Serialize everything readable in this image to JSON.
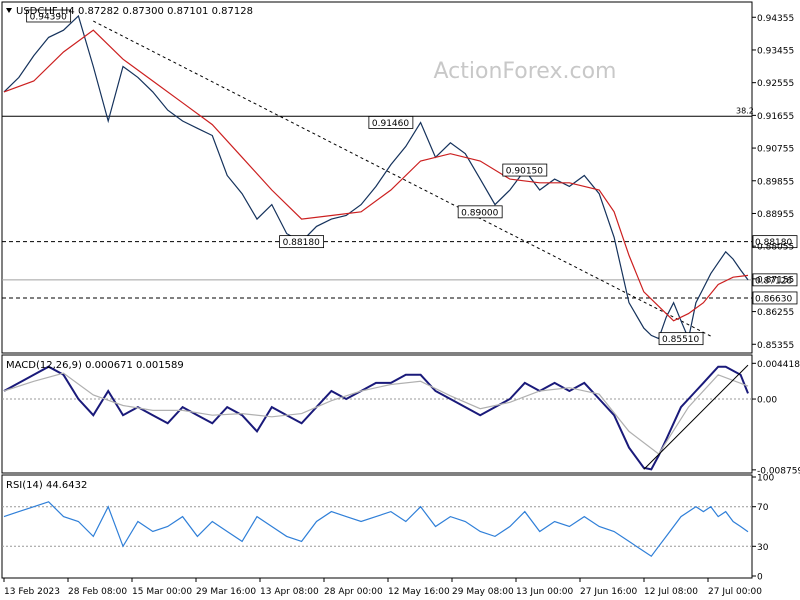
{
  "chart_data": [
    {
      "type": "line",
      "panel": "price",
      "title": "USDCHF,H4",
      "ohlc": "0.87282 0.87300 0.87101 0.87128",
      "watermark": "ActionForex.com",
      "y_ticks": [
        "0.94355",
        "0.93455",
        "0.92555",
        "0.91655",
        "0.90755",
        "0.89855",
        "0.88955",
        "0.88055",
        "0.87155",
        "0.86255",
        "0.85355"
      ],
      "ylim": [
        0.8517,
        0.9472
      ],
      "x_ticks": [
        "13 Feb 2023",
        "28 Feb 08:00",
        "15 Mar 00:00",
        "29 Mar 16:00",
        "13 Apr 08:00",
        "28 Apr 00:00",
        "12 May 16:00",
        "29 May 08:00",
        "13 Jun 00:00",
        "27 Jun 16:00",
        "12 Jul 08:00",
        "27 Jul 00:00"
      ],
      "levels": [
        {
          "label": "38.2",
          "value": 0.9163,
          "style": "solid"
        },
        {
          "label": "0.88180",
          "value": 0.8818,
          "style": "dashed"
        },
        {
          "label": "0.86630",
          "value": 0.8663,
          "style": "dashed"
        },
        {
          "label": "0.87128",
          "value": 0.87128,
          "style": "current"
        }
      ],
      "annotations": [
        {
          "text": "0.94390",
          "x": 0.06,
          "y": 0.9439
        },
        {
          "text": "0.91460",
          "x": 0.52,
          "y": 0.9146
        },
        {
          "text": "0.90150",
          "x": 0.7,
          "y": 0.9015
        },
        {
          "text": "0.89000",
          "x": 0.64,
          "y": 0.89
        },
        {
          "text": "0.88180",
          "x": 0.4,
          "y": 0.8818
        },
        {
          "text": "0.85510",
          "x": 0.91,
          "y": 0.8551
        }
      ],
      "trendline": {
        "from": [
          0.12,
          0.9425
        ],
        "to": [
          0.95,
          0.8558
        ]
      },
      "series": [
        {
          "name": "price",
          "color": "#15325c",
          "x": [
            0.0,
            0.02,
            0.04,
            0.06,
            0.08,
            0.1,
            0.12,
            0.14,
            0.16,
            0.18,
            0.2,
            0.22,
            0.24,
            0.26,
            0.28,
            0.3,
            0.32,
            0.34,
            0.36,
            0.38,
            0.4,
            0.42,
            0.44,
            0.46,
            0.48,
            0.5,
            0.52,
            0.54,
            0.56,
            0.58,
            0.6,
            0.62,
            0.64,
            0.66,
            0.68,
            0.7,
            0.72,
            0.74,
            0.76,
            0.78,
            0.8,
            0.82,
            0.84,
            0.86,
            0.87,
            0.88,
            0.89,
            0.9,
            0.91,
            0.92,
            0.93,
            0.94,
            0.95,
            0.96,
            0.97,
            0.98,
            0.99,
            1.0
          ],
          "y": [
            0.923,
            0.927,
            0.933,
            0.938,
            0.94,
            0.9439,
            0.93,
            0.915,
            0.93,
            0.927,
            0.923,
            0.918,
            0.915,
            0.913,
            0.911,
            0.9,
            0.895,
            0.888,
            0.892,
            0.884,
            0.8818,
            0.886,
            0.888,
            0.889,
            0.892,
            0.897,
            0.903,
            0.908,
            0.9146,
            0.905,
            0.909,
            0.906,
            0.899,
            0.892,
            0.896,
            0.9015,
            0.896,
            0.899,
            0.897,
            0.9,
            0.895,
            0.883,
            0.865,
            0.858,
            0.856,
            0.8551,
            0.861,
            0.865,
            0.86,
            0.8551,
            0.865,
            0.869,
            0.873,
            0.876,
            0.879,
            0.877,
            0.874,
            0.87128
          ]
        },
        {
          "name": "ma",
          "color": "#cc2020",
          "x": [
            0.0,
            0.04,
            0.08,
            0.12,
            0.16,
            0.2,
            0.24,
            0.28,
            0.32,
            0.36,
            0.4,
            0.44,
            0.48,
            0.52,
            0.56,
            0.6,
            0.64,
            0.68,
            0.72,
            0.76,
            0.8,
            0.82,
            0.84,
            0.86,
            0.88,
            0.9,
            0.92,
            0.94,
            0.96,
            0.98,
            1.0
          ],
          "y": [
            0.923,
            0.926,
            0.934,
            0.94,
            0.932,
            0.926,
            0.92,
            0.914,
            0.905,
            0.896,
            0.888,
            0.889,
            0.89,
            0.896,
            0.904,
            0.906,
            0.904,
            0.899,
            0.898,
            0.898,
            0.896,
            0.89,
            0.878,
            0.868,
            0.864,
            0.86,
            0.862,
            0.865,
            0.87,
            0.872,
            0.8725
          ]
        }
      ]
    },
    {
      "type": "line",
      "panel": "macd",
      "title": "MACD(12,26,9) 0.000671 0.001589",
      "y_ticks": [
        "0.004418",
        "0.00",
        "-0.008759"
      ],
      "ylim": [
        -0.0089,
        0.0052
      ],
      "series": [
        {
          "name": "macd",
          "color": "#1a1a7a",
          "x": [
            0.0,
            0.02,
            0.04,
            0.06,
            0.08,
            0.1,
            0.12,
            0.14,
            0.16,
            0.18,
            0.2,
            0.22,
            0.24,
            0.26,
            0.28,
            0.3,
            0.32,
            0.34,
            0.36,
            0.38,
            0.4,
            0.42,
            0.44,
            0.46,
            0.48,
            0.5,
            0.52,
            0.54,
            0.56,
            0.58,
            0.6,
            0.62,
            0.64,
            0.66,
            0.68,
            0.7,
            0.72,
            0.74,
            0.76,
            0.78,
            0.8,
            0.82,
            0.84,
            0.86,
            0.87,
            0.88,
            0.89,
            0.9,
            0.91,
            0.92,
            0.93,
            0.94,
            0.95,
            0.96,
            0.97,
            0.98,
            0.99,
            1.0
          ],
          "y": [
            0.001,
            0.002,
            0.003,
            0.004,
            0.003,
            0.0,
            -0.002,
            0.001,
            -0.002,
            -0.001,
            -0.002,
            -0.003,
            -0.001,
            -0.002,
            -0.003,
            -0.001,
            -0.002,
            -0.004,
            -0.001,
            -0.002,
            -0.003,
            -0.001,
            0.001,
            0.0,
            0.001,
            0.002,
            0.002,
            0.003,
            0.003,
            0.001,
            0.0,
            -0.001,
            -0.002,
            -0.001,
            0.0,
            0.002,
            0.001,
            0.002,
            0.001,
            0.002,
            0.0,
            -0.002,
            -0.006,
            -0.0085,
            -0.0087,
            -0.007,
            -0.005,
            -0.003,
            -0.001,
            0.0,
            0.001,
            0.002,
            0.003,
            0.004,
            0.004,
            0.0035,
            0.003,
            0.0007
          ]
        },
        {
          "name": "signal",
          "color": "#b0b0b0",
          "x": [
            0.0,
            0.04,
            0.08,
            0.12,
            0.16,
            0.2,
            0.24,
            0.28,
            0.32,
            0.36,
            0.4,
            0.44,
            0.48,
            0.52,
            0.56,
            0.6,
            0.64,
            0.68,
            0.72,
            0.76,
            0.8,
            0.84,
            0.88,
            0.92,
            0.96,
            1.0
          ],
          "y": [
            0.001,
            0.0022,
            0.0032,
            0.0005,
            -0.0008,
            -0.0014,
            -0.0014,
            -0.002,
            -0.0018,
            -0.0022,
            -0.0018,
            -0.0002,
            0.001,
            0.0018,
            0.0022,
            0.0004,
            -0.0012,
            -0.0004,
            0.001,
            0.0014,
            0.0006,
            -0.004,
            -0.0068,
            -0.001,
            0.003,
            0.0016
          ]
        }
      ],
      "trendline": {
        "from": [
          0.86,
          -0.0087
        ],
        "to": [
          1.0,
          0.0042
        ]
      }
    },
    {
      "type": "line",
      "panel": "rsi",
      "title": "RSI(14) 44.6432",
      "y_ticks": [
        "100",
        "70",
        "30",
        "0"
      ],
      "ylim": [
        0,
        100
      ],
      "levels": [
        70,
        30
      ],
      "series": [
        {
          "name": "rsi",
          "color": "#2f7fd8",
          "x": [
            0.0,
            0.02,
            0.04,
            0.06,
            0.08,
            0.1,
            0.12,
            0.14,
            0.16,
            0.18,
            0.2,
            0.22,
            0.24,
            0.26,
            0.28,
            0.3,
            0.32,
            0.34,
            0.36,
            0.38,
            0.4,
            0.42,
            0.44,
            0.46,
            0.48,
            0.5,
            0.52,
            0.54,
            0.56,
            0.58,
            0.6,
            0.62,
            0.64,
            0.66,
            0.68,
            0.7,
            0.72,
            0.74,
            0.76,
            0.78,
            0.8,
            0.82,
            0.84,
            0.86,
            0.87,
            0.88,
            0.89,
            0.9,
            0.91,
            0.92,
            0.93,
            0.94,
            0.95,
            0.96,
            0.97,
            0.98,
            0.99,
            1.0
          ],
          "y": [
            60,
            65,
            70,
            75,
            60,
            55,
            40,
            70,
            30,
            55,
            45,
            50,
            60,
            40,
            55,
            45,
            35,
            60,
            50,
            40,
            35,
            55,
            65,
            60,
            55,
            60,
            65,
            55,
            70,
            50,
            60,
            55,
            45,
            40,
            50,
            65,
            45,
            55,
            50,
            60,
            50,
            45,
            35,
            25,
            20,
            30,
            40,
            50,
            60,
            65,
            70,
            65,
            70,
            60,
            65,
            55,
            50,
            44.6
          ]
        }
      ]
    }
  ]
}
